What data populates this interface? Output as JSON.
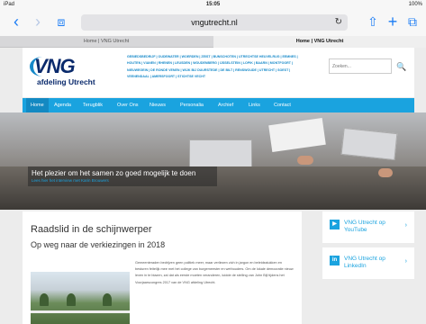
{
  "status": {
    "device": "iPad",
    "wifi": "wifi-icon",
    "time": "15:05",
    "battery": "100%"
  },
  "toolbar": {
    "url": "vngutrecht.nl",
    "back_icon": "chevron-left-icon",
    "forward_icon": "chevron-right-icon",
    "bookmarks_icon": "book-icon",
    "reload_icon": "reload-icon",
    "share_icon": "share-icon",
    "new_tab_icon": "plus-icon",
    "tabs_icon": "tabs-icon",
    "glyph_back": "‹",
    "glyph_forward": "›",
    "glyph_book": "⧈",
    "glyph_reload": "↻",
    "glyph_share": "⇧",
    "glyph_plus": "+",
    "glyph_tabs": "⧉"
  },
  "tabs": [
    {
      "label": "Home | VNG Utrecht"
    },
    {
      "label": "Home | VNG Utrecht"
    }
  ],
  "tab_close": "⊗",
  "header": {
    "logo_text": "VNG",
    "logo_sub": "afdeling Utrecht",
    "municipalities": "Gebiedsbedrijf | Oudewater | Woerden | Zeist | Bunschoten | Utrechtse Heuvelrug | Eemnes | Houten | Vianen | Rhenen | Leusden | Woudenberg | IJsselstein | Lopik | Baarn | Montfoort | Nieuwegein | De Ronde Venen | Wijk bij Duurstede | De Bilt | Renswoude | Utrecht | Soest | Veenendaal | Amersfoort | Stichtse Vecht",
    "search_placeholder": "Zoeken...",
    "search_icon": "search-icon",
    "search_glyph": "🔍"
  },
  "nav": [
    {
      "label": "Home",
      "active": true
    },
    {
      "label": "Agenda"
    },
    {
      "label": "Terugblik"
    },
    {
      "label": "Over Ons"
    },
    {
      "label": "Nieuws"
    },
    {
      "label": "Personalia"
    },
    {
      "label": "Archief"
    },
    {
      "label": "Links"
    },
    {
      "label": "Contact"
    }
  ],
  "hero": {
    "title": "Het plezier om het samen zo goed mogelijk te doen",
    "subtitle": "Lees hier het interview met Karin Brouwers"
  },
  "article": {
    "title": "Raadslid in de schijnwerper",
    "subtitle": "Op weg naar de verkiezingen in 2018",
    "body": "Gemeenteraden bedrijven geen politiek meer, maar verliezen zich in jargon en beleidsstukken en besturen feitelijk mee met het college van burgemeester en wethouders. Om de lokale democratie nieuw leven in te blazen, zal dat als eerste moeten veranderen, luidde de stelling van John Bijl tijdens het Voorjaarscongres 2017 van de VNG afdeling Utrecht."
  },
  "side": [
    {
      "label": "VNG Utrecht op YouTube",
      "icon": "youtube-icon",
      "glyph": "▶"
    },
    {
      "label": "VNG Utrecht op LinkedIn",
      "icon": "linkedin-icon",
      "glyph": "in"
    }
  ],
  "side_arrow": "›",
  "colors": {
    "accent": "#1aa3df",
    "brand_dark": "#0a2a6c",
    "nav_active": "#1389c2"
  }
}
